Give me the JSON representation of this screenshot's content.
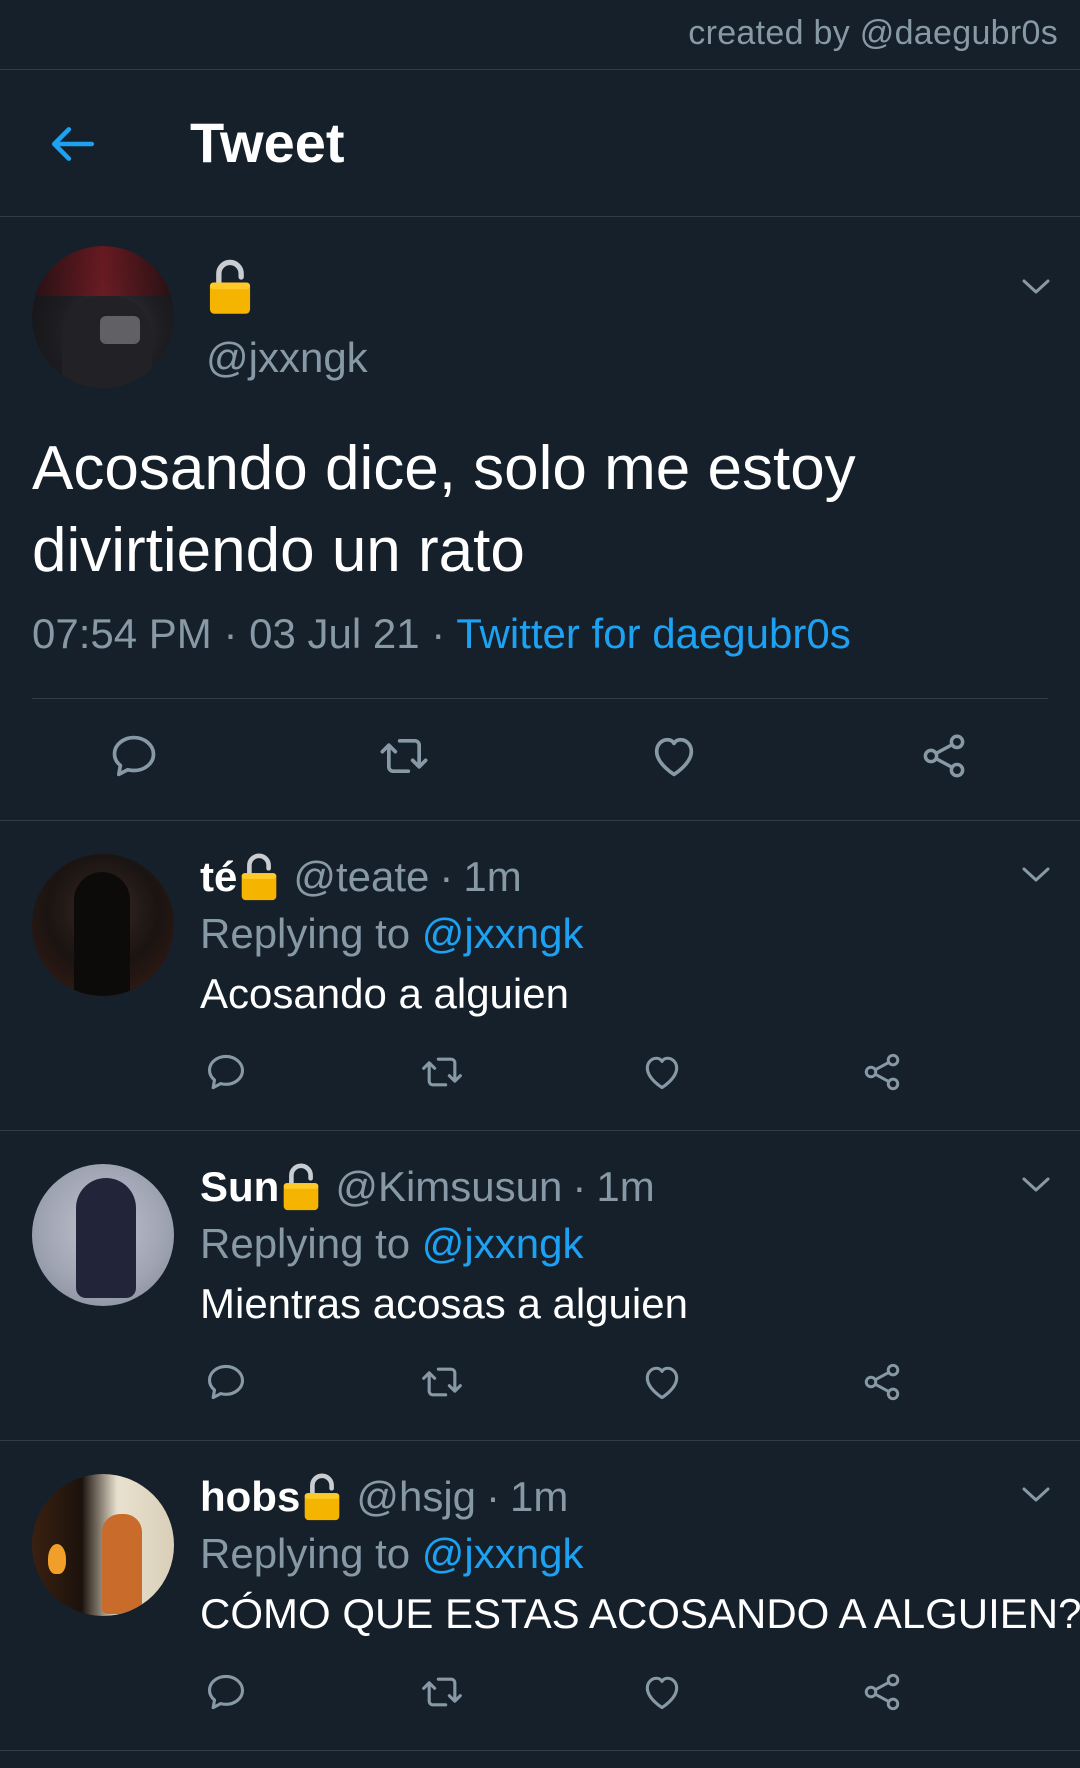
{
  "credit": "created by @daegubr0s",
  "header": {
    "title": "Tweet",
    "back_icon": "arrow-left-icon"
  },
  "colors": {
    "background": "#15202b",
    "accent": "#1da1f2",
    "muted": "#8899a6",
    "divider": "#2f3d4a",
    "lock": "#f5b400"
  },
  "tweet": {
    "name_icon": "lock-icon",
    "handle": "@jxxngk",
    "text": "Acosando dice, solo me estoy divirtiendo un rato",
    "time": "07:54 PM",
    "date": "03 Jul 21",
    "source": "Twitter for daegubr0s",
    "dot": "·"
  },
  "actions": [
    "reply-icon",
    "retweet-icon",
    "like-icon",
    "share-icon"
  ],
  "replies": [
    {
      "name": "té",
      "handle": "@teate",
      "time": "1m",
      "replying_label": "Replying to",
      "replying_to": "@jxxngk",
      "text": "Acosando a alguien"
    },
    {
      "name": "Sun",
      "handle": "@Kimsusun",
      "time": "1m",
      "replying_label": "Replying to",
      "replying_to": "@jxxngk",
      "text": "Mientras acosas a alguien"
    },
    {
      "name": "hobs",
      "handle": "@hsjg",
      "time": "1m",
      "replying_label": "Replying to",
      "replying_to": "@jxxngk",
      "text": "CÓMO QUE ESTAS ACOSANDO A ALGUIEN?"
    }
  ]
}
